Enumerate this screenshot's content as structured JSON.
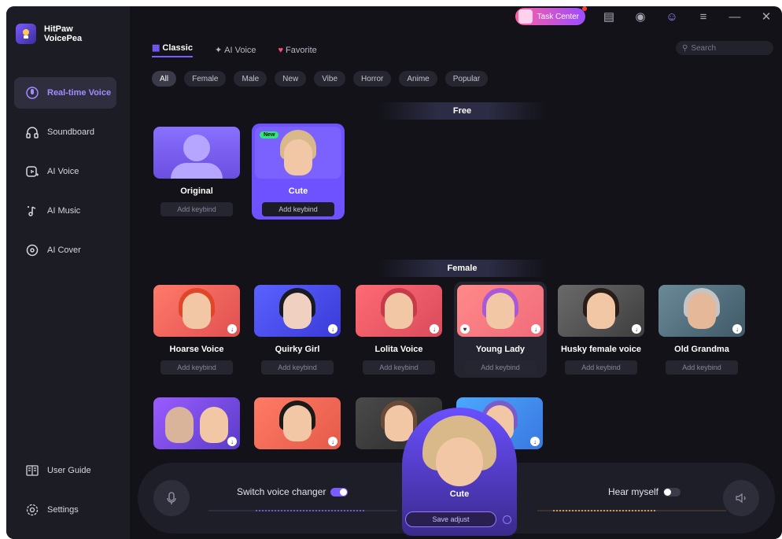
{
  "app": {
    "name_line1": "HitPaw",
    "name_line2": "VoicePea"
  },
  "sidebar": {
    "items": [
      {
        "label": "Real-time Voice",
        "icon": "microphone-icon",
        "active": true
      },
      {
        "label": "Soundboard",
        "icon": "headphones-icon",
        "active": false
      },
      {
        "label": "AI Voice",
        "icon": "ai-voice-icon",
        "active": false
      },
      {
        "label": "AI Music",
        "icon": "music-note-icon",
        "active": false
      },
      {
        "label": "AI Cover",
        "icon": "disc-icon",
        "active": false
      }
    ],
    "bottom": [
      {
        "label": "User Guide",
        "icon": "book-icon"
      },
      {
        "label": "Settings",
        "icon": "gear-icon"
      }
    ]
  },
  "topbar": {
    "task_center": "Task Center"
  },
  "tabs": [
    {
      "label": "Classic",
      "active": true
    },
    {
      "label": "AI Voice",
      "active": false
    },
    {
      "label": "Favorite",
      "active": false
    }
  ],
  "search": {
    "placeholder": "Search"
  },
  "chips": [
    "All",
    "Female",
    "Male",
    "New",
    "Vibe",
    "Horror",
    "Anime",
    "Popular"
  ],
  "sections": {
    "free": "Free",
    "female": "Female"
  },
  "free_cards": [
    {
      "name": "Original",
      "keybind": "Add keybind"
    },
    {
      "name": "Cute",
      "keybind": "Add keybind",
      "badge": "New"
    }
  ],
  "female_cards": [
    {
      "name": "Hoarse Voice",
      "keybind": "Add keybind"
    },
    {
      "name": "Quirky Girl",
      "keybind": "Add keybind"
    },
    {
      "name": "Lolita Voice",
      "keybind": "Add keybind"
    },
    {
      "name": "Young Lady",
      "keybind": "Add keybind"
    },
    {
      "name": "Husky female voice",
      "keybind": "Add keybind"
    },
    {
      "name": "Old Grandma",
      "keybind": "Add keybind"
    }
  ],
  "bottom_bar": {
    "switch_label": "Switch voice changer",
    "hear_label": "Hear myself",
    "current_voice": "Cute",
    "save_adjust": "Save adjust"
  },
  "colors": {
    "accent": "#7b5cff",
    "background": "#121218",
    "sidebar": "#1c1c24"
  }
}
